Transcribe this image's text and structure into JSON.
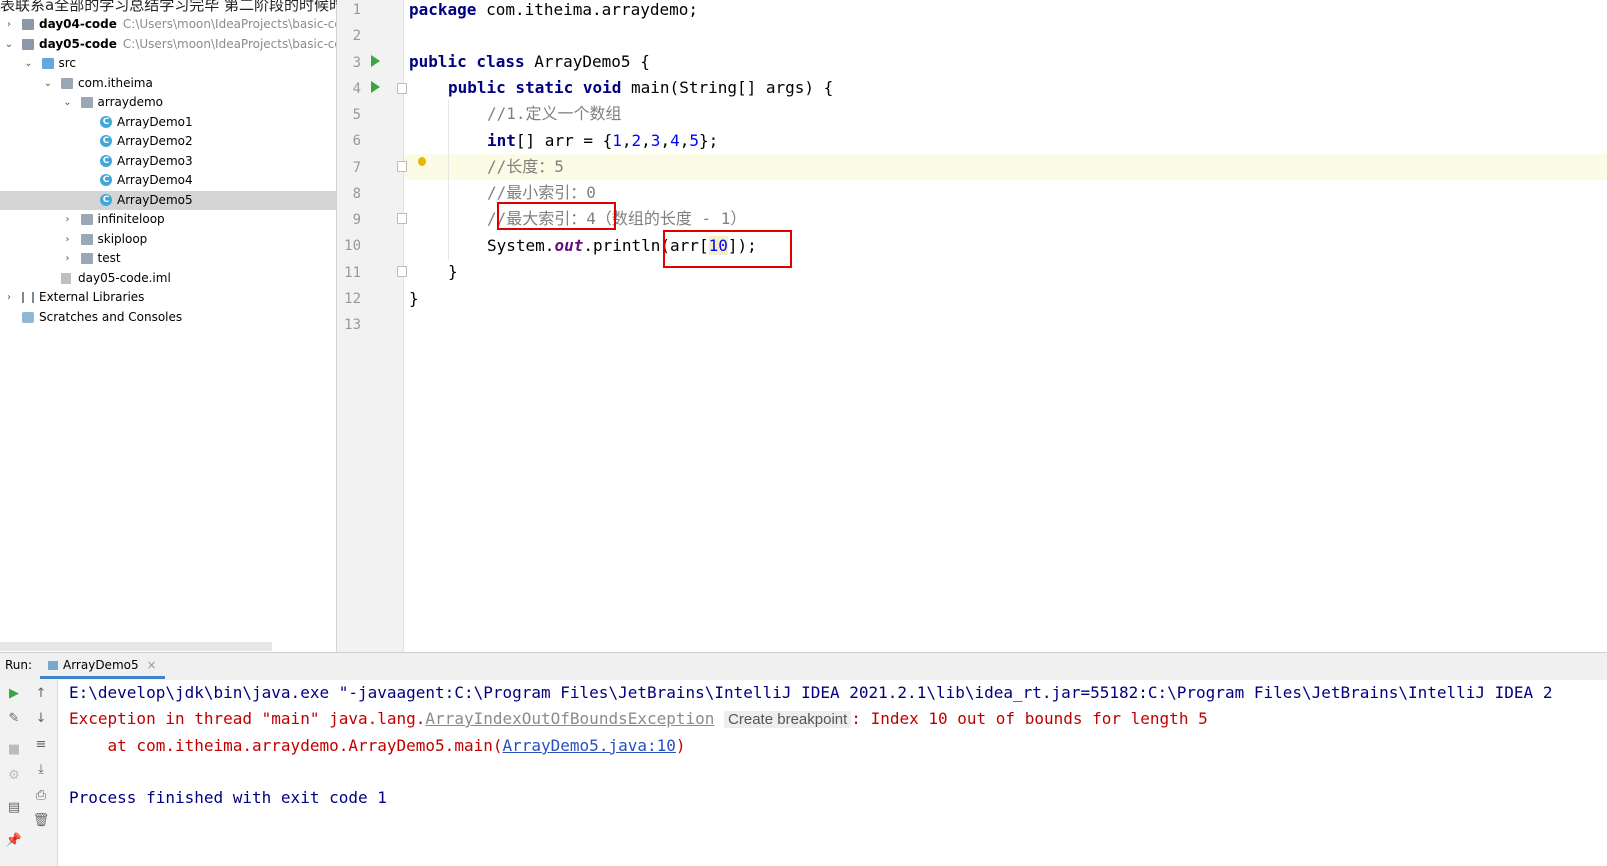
{
  "overlay_text": "表联系a全部的学习总结学习完毕 第二阶段的时候时候再来学习",
  "project_tree": [
    {
      "label": "day04-code",
      "path": "C:\\Users\\moon\\IdeaProjects\\basic-code",
      "bold": true,
      "icon": "module-icon",
      "twisty": "›",
      "indent": 0
    },
    {
      "label": "day05-code",
      "path": "C:\\Users\\moon\\IdeaProjects\\basic-code",
      "bold": true,
      "icon": "module-icon",
      "twisty": "⌄",
      "indent": 0
    },
    {
      "label": "src",
      "icon": "source-folder-icon",
      "twisty": "⌄",
      "indent": 1
    },
    {
      "label": "com.itheima",
      "icon": "package-icon",
      "twisty": "⌄",
      "indent": 2
    },
    {
      "label": "arraydemo",
      "icon": "package-icon",
      "twisty": "⌄",
      "indent": 3
    },
    {
      "label": "ArrayDemo1",
      "icon": "java-class-icon",
      "indent": 4
    },
    {
      "label": "ArrayDemo2",
      "icon": "java-class-icon",
      "indent": 4
    },
    {
      "label": "ArrayDemo3",
      "icon": "java-class-icon",
      "indent": 4
    },
    {
      "label": "ArrayDemo4",
      "icon": "java-class-icon",
      "indent": 4
    },
    {
      "label": "ArrayDemo5",
      "icon": "java-class-icon",
      "indent": 4,
      "selected": true
    },
    {
      "label": "infiniteloop",
      "icon": "package-icon",
      "twisty": "›",
      "indent": 3
    },
    {
      "label": "skiploop",
      "icon": "package-icon",
      "twisty": "›",
      "indent": 3
    },
    {
      "label": "test",
      "icon": "package-icon",
      "twisty": "›",
      "indent": 3
    },
    {
      "label": "day05-code.iml",
      "icon": "iml-file-icon",
      "indent": 2
    },
    {
      "label": "External Libraries",
      "icon": "libraries-icon",
      "twisty": "›",
      "indent": 0
    },
    {
      "label": "Scratches and Consoles",
      "icon": "scratches-icon",
      "indent": 0
    }
  ],
  "editor": {
    "line_numbers": [
      "1",
      "2",
      "3",
      "4",
      "5",
      "6",
      "7",
      "8",
      "9",
      "10",
      "11",
      "12",
      "13"
    ],
    "line1_tail": "com.itheima.arraydemo;",
    "line1_kw": "package",
    "line3": {
      "kw": "public class",
      "rest": " ArrayDemo5 {"
    },
    "line4": {
      "kw": "public static void",
      "rest": " main(String[] args) {"
    },
    "line5": "//1.定义一个数组",
    "line6": {
      "kw": "int",
      "rest": "[] arr = {",
      "nums": [
        "1",
        "2",
        "3",
        "4",
        "5"
      ],
      "end": "};"
    },
    "line7": "//长度：5",
    "line8": "//最小索引：0",
    "line9": "//最大索引：4（数组的长度 - 1）",
    "line10": {
      "pre": "System.",
      "field": "out",
      "mid": ".println(arr[",
      "idx": "10",
      "end": "]);"
    },
    "line11": "}",
    "line12": "}"
  },
  "run_panel": {
    "label": "Run:",
    "tab_title": "ArrayDemo5",
    "tab_close": "×",
    "cmd_line": "E:\\develop\\jdk\\bin\\java.exe \"-javaagent:C:\\Program Files\\JetBrains\\IntelliJ IDEA 2021.2.1\\lib\\idea_rt.jar=55182:C:\\Program Files\\JetBrains\\IntelliJ IDEA 2",
    "exc_prefix": "Exception in thread \"main\" java.lang.",
    "exc_class": "ArrayIndexOutOfBoundsException",
    "create_breakpoint": "Create breakpoint",
    "exc_msg": ": Index 10 out of bounds for length 5",
    "at_prefix": "    at com.itheima.arraydemo.ArrayDemo5.main(",
    "at_link": "ArrayDemo5.java:10",
    "at_suffix": ")",
    "exit_line": "Process finished with exit code 1"
  },
  "colors": {
    "accent": "#4083c9",
    "annotation_red": "#e00000",
    "keyword": "#000080",
    "comment": "#808080",
    "number": "#0000ff"
  }
}
